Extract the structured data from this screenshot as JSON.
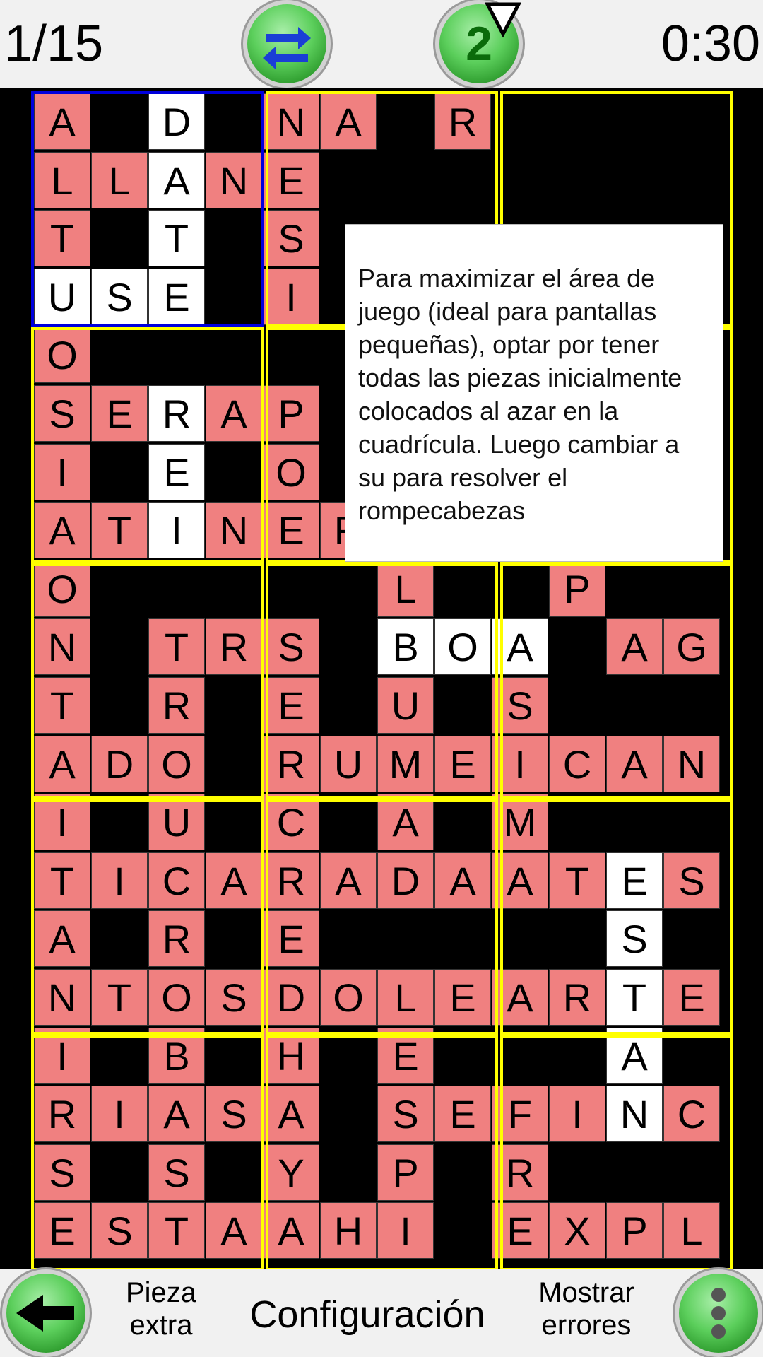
{
  "header": {
    "progress": "1/15",
    "hint_count": "2",
    "timer": "0:30",
    "icons": {
      "swap": "swap-arrows-icon",
      "hint": "hint-icon",
      "dropdown": "dropdown-triangle-icon"
    }
  },
  "board": {
    "colors": {
      "letter_cell": "#f08080",
      "fixed_cell": "#ffffff",
      "piece_border": "#ffff00",
      "selected_border": "#0000dd",
      "background": "#000000"
    },
    "rows": [
      "A.D.NA.R...",
      "LLANE......",
      "T.T.S......",
      "USE.I......",
      "O..........",
      "SERAP......",
      "I.E.O.D..I.",
      "ATINERONTRUY",
      "O.....L..P.",
      "N.TRS.BOA.AG",
      "T.R.E.U.S...",
      "ADO.RUMEICAN",
      "I.U.C.A.M...",
      "TICARADAATES",
      "A.R.E.....S.",
      "NTOSDOLEARTE",
      "I.B.H.E...A.",
      "RIASA.SEFINC",
      "S.S.Y.P.R...",
      "ESTAAHI.EXPL"
    ],
    "white_cells": [
      [
        0,
        2
      ],
      [
        1,
        2
      ],
      [
        2,
        2
      ],
      [
        3,
        0
      ],
      [
        3,
        1
      ],
      [
        3,
        2
      ],
      [
        5,
        2
      ],
      [
        6,
        2
      ],
      [
        7,
        2
      ],
      [
        9,
        6
      ],
      [
        9,
        7
      ],
      [
        9,
        8
      ],
      [
        13,
        10
      ],
      [
        14,
        10
      ],
      [
        15,
        10
      ],
      [
        16,
        10
      ],
      [
        17,
        10
      ]
    ]
  },
  "tooltip": {
    "text": "Para maximizar el área de juego (ideal para pantallas pequeñas), optar por tener todas las piezas inicialmente colocados al azar en la cuadrícula. Luego cambiar a su para resolver el rompecabezas"
  },
  "footer": {
    "extra_piece_line1": "Pieza",
    "extra_piece_line2": "extra",
    "settings": "Configuración",
    "show_errors_line1": "Mostrar",
    "show_errors_line2": "errores",
    "icons": {
      "back": "back-arrow-icon",
      "more": "more-vertical-icon"
    }
  }
}
